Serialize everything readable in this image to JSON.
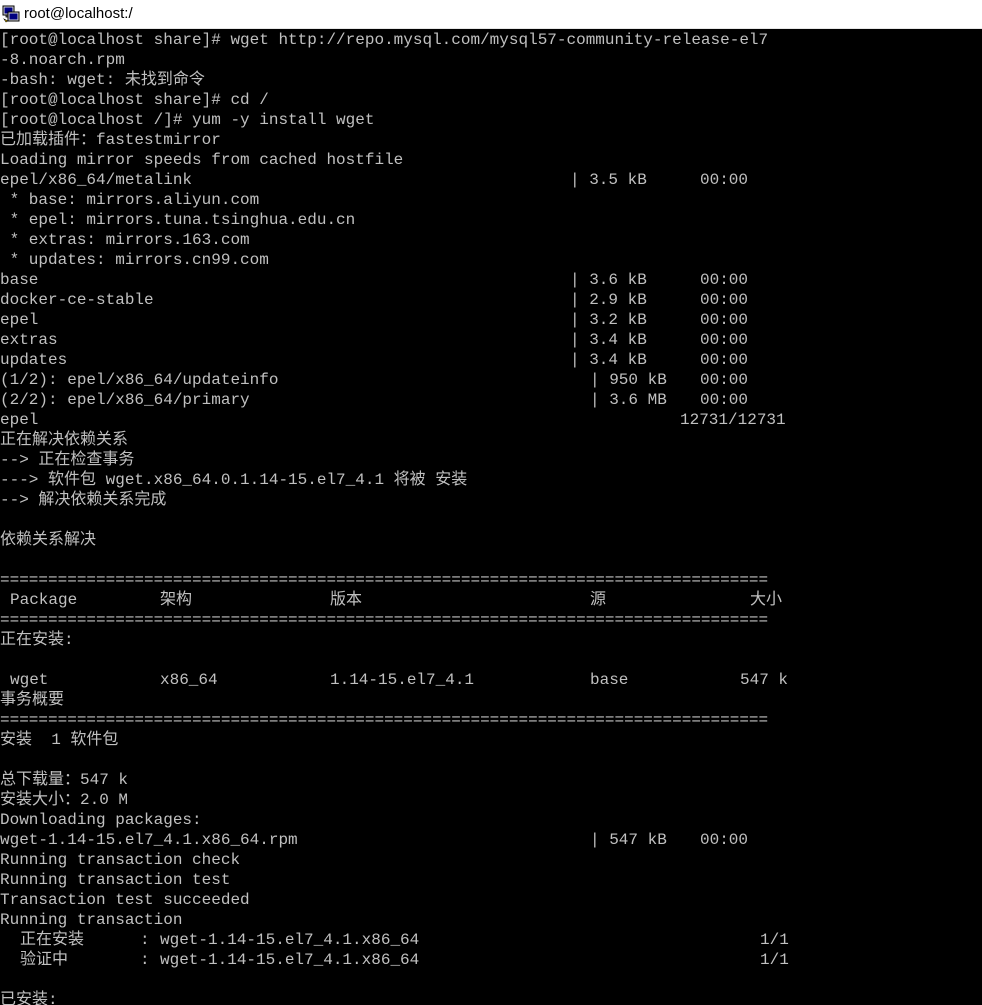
{
  "window": {
    "title": "root@localhost:/",
    "icon": "putty-terminal-icon"
  },
  "colors": {
    "terminal_bg": "#000000",
    "terminal_fg": "#c0c0c0",
    "titlebar_bg": "#ffffff"
  },
  "terminal": {
    "lines": [
      "[root@localhost share]# wget http://repo.mysql.com/mysql57-community-release-el7",
      "-8.noarch.rpm",
      "-bash: wget: 未找到命令",
      "[root@localhost share]# cd /",
      "[root@localhost /]# yum -y install wget",
      "已加载插件：fastestmirror",
      "Loading mirror speeds from cached hostfile",
      "epel/x86_64/metalink",
      " * base: mirrors.aliyun.com",
      " * epel: mirrors.tuna.tsinghua.edu.cn",
      " * extras: mirrors.163.com",
      " * updates: mirrors.cn99.com",
      "base",
      "docker-ce-stable",
      "epel",
      "extras",
      "updates",
      "(1/2): epel/x86_64/updateinfo",
      "(2/2): epel/x86_64/primary",
      "epel",
      "正在解决依赖关系",
      "--> 正在检查事务",
      "---> 软件包 wget.x86_64.0.1.14-15.el7_4.1 将被 安装",
      "--> 解决依赖关系完成",
      "",
      "依赖关系解决",
      "",
      "================================================================================",
      "",
      "================================================================================",
      "正在安装:",
      "",
      "",
      "事务概要",
      "================================================================================",
      "安装  1 软件包",
      "",
      "总下载量：547 k",
      "安装大小：2.0 M",
      "Downloading packages:",
      "wget-1.14-15.el7_4.1.x86_64.rpm",
      "Running transaction check",
      "Running transaction test",
      "Transaction test succeeded",
      "Running transaction",
      "",
      "",
      "",
      "已安装:"
    ],
    "repo_stats": [
      {
        "line": 7,
        "size": "| 3.5 kB",
        "time": "00:00"
      },
      {
        "line": 12,
        "size": "| 3.6 kB",
        "time": "00:00"
      },
      {
        "line": 13,
        "size": "| 2.9 kB",
        "time": "00:00"
      },
      {
        "line": 14,
        "size": "| 3.2 kB",
        "time": "00:00"
      },
      {
        "line": 15,
        "size": "| 3.4 kB",
        "time": "00:00"
      },
      {
        "line": 16,
        "size": "| 3.4 kB",
        "time": "00:00"
      }
    ],
    "download_stats": [
      {
        "line": 17,
        "size": "| 950 kB",
        "time": "00:00"
      },
      {
        "line": 18,
        "size": "| 3.6 MB",
        "time": "00:00"
      },
      {
        "line": 40,
        "size": "| 547 kB",
        "time": "00:00"
      }
    ],
    "epel_progress": "12731/12731",
    "table_header": {
      "package": "Package",
      "arch": "架构",
      "version": "版本",
      "repo": "源",
      "size": "大小"
    },
    "table_row": {
      "package": "wget",
      "arch": "x86_64",
      "version": "1.14-15.el7_4.1",
      "repo": "base",
      "size": "547 k"
    },
    "tx_steps": [
      {
        "label": "正在安装",
        "sep": ":",
        "pkg": "wget-1.14-15.el7_4.1.x86_64",
        "count": "1/1"
      },
      {
        "label": "验证中",
        "sep": ":",
        "pkg": "wget-1.14-15.el7_4.1.x86_64",
        "count": "1/1"
      }
    ]
  }
}
